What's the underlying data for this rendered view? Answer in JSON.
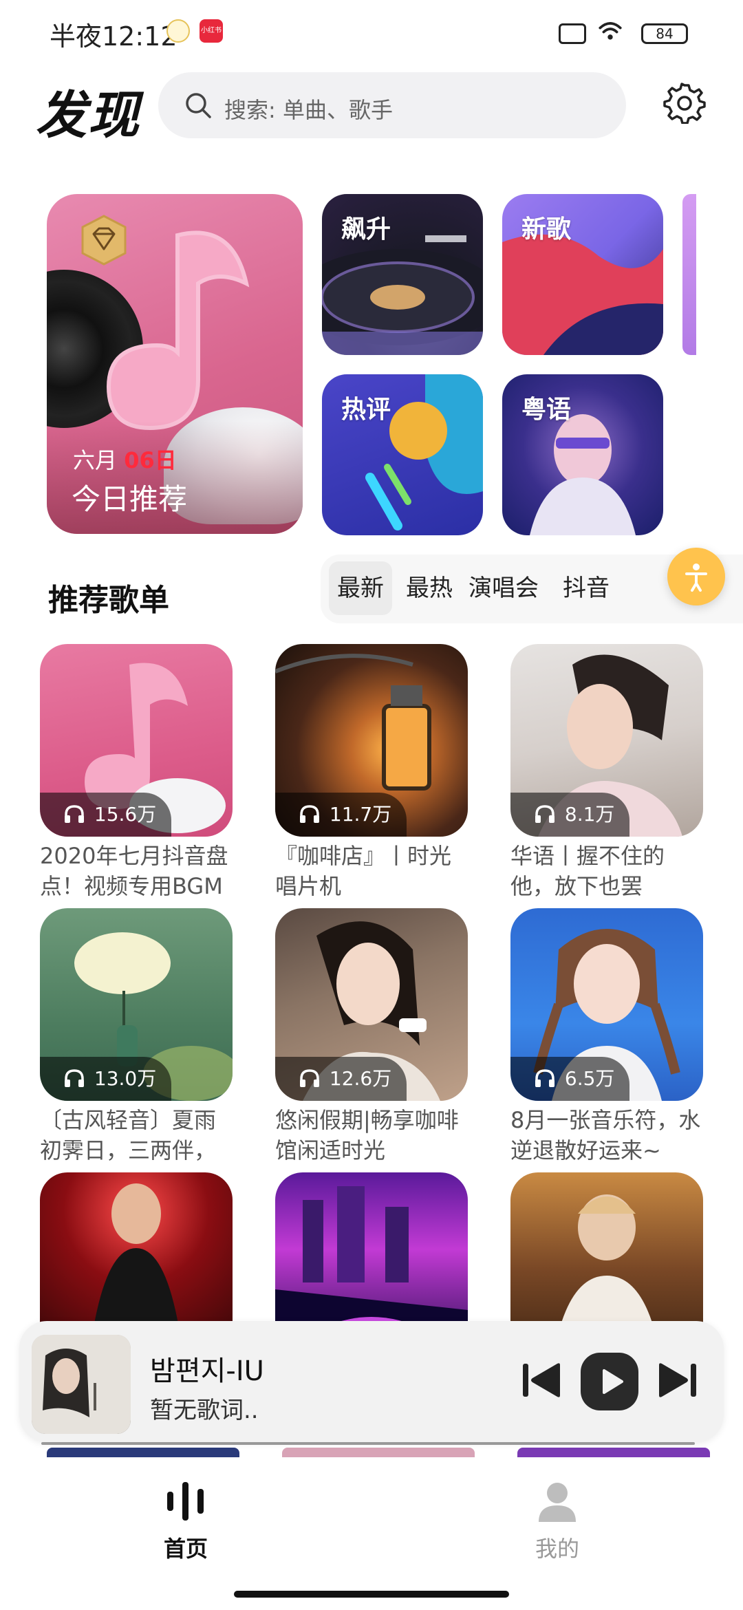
{
  "status_bar": {
    "time": "半夜12:12",
    "battery": "84",
    "notification_app": "小红书"
  },
  "header": {
    "title": "发现",
    "search_placeholder": "搜索: 单曲、歌手"
  },
  "featured": {
    "daily": {
      "month": "六月",
      "day": "06日",
      "label": "今日推荐"
    },
    "charts": [
      {
        "label": "飙升"
      },
      {
        "label": "新歌"
      },
      {
        "label": "热评"
      },
      {
        "label": "粤语"
      }
    ]
  },
  "section": {
    "title": "推荐歌单",
    "tabs": [
      "最新",
      "最热",
      "演唱会",
      "抖音"
    ],
    "active_tab": "最新"
  },
  "playlists": [
    {
      "title": "2020年七月抖音盘点！视频专用BGM",
      "plays": "15.6万"
    },
    {
      "title": "『咖啡店』丨时光唱片机",
      "plays": "11.7万"
    },
    {
      "title": "华语丨握不住的他，放下也罢",
      "plays": "8.1万"
    },
    {
      "title": "〔古风轻音〕夏雨初霁日，三两伴，",
      "plays": "13.0万"
    },
    {
      "title": "悠闲假期|畅享咖啡馆闲适时光",
      "plays": "12.6万"
    },
    {
      "title": "8月一张音乐符，水逆退散好运来~",
      "plays": "6.5万"
    },
    {
      "title": "",
      "plays": ""
    },
    {
      "title": "",
      "plays": ""
    },
    {
      "title": "",
      "plays": ""
    }
  ],
  "player": {
    "song": "밤편지-IU",
    "lyric": "暂无歌词.."
  },
  "nav": {
    "home": "首页",
    "mine": "我的"
  },
  "colors": {
    "accent_red": "#ff2a3c",
    "float_button": "#ffc34d"
  }
}
